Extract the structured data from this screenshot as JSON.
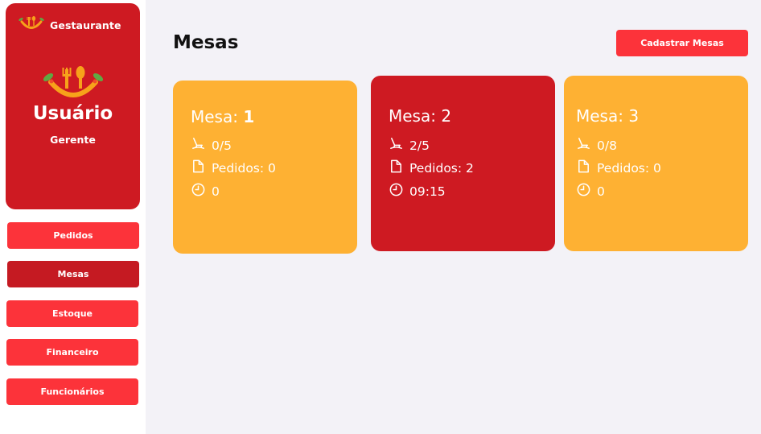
{
  "brand": {
    "name": "Gestaurante"
  },
  "user": {
    "name": "Usuário",
    "role": "Gerente"
  },
  "nav": [
    {
      "label": "Pedidos",
      "active": false
    },
    {
      "label": "Mesas",
      "active": true
    },
    {
      "label": "Estoque",
      "active": false
    },
    {
      "label": "Financeiro",
      "active": false
    },
    {
      "label": "Funcionários",
      "active": false
    }
  ],
  "page": {
    "title": "Mesas",
    "add_button": "Cadastrar Mesas"
  },
  "tables": [
    {
      "label": "Mesa:",
      "number": "1",
      "occupancy": "0/5",
      "orders": "Pedidos: 0",
      "time": "0",
      "color": "#feb133"
    },
    {
      "label": "Mesa:",
      "number": "2",
      "occupancy": "2/5",
      "orders": "Pedidos: 2",
      "time": "09:15",
      "color": "#ce1a22"
    },
    {
      "label": "Mesa:",
      "number": "3",
      "occupancy": "0/8",
      "orders": "Pedidos: 0",
      "time": "0",
      "color": "#feb133"
    }
  ],
  "colors": {
    "primary": "#ce1a22",
    "button": "#fc333a",
    "free_table": "#feb133",
    "occupied_table": "#ce1a22",
    "background": "#f3f2f7"
  }
}
